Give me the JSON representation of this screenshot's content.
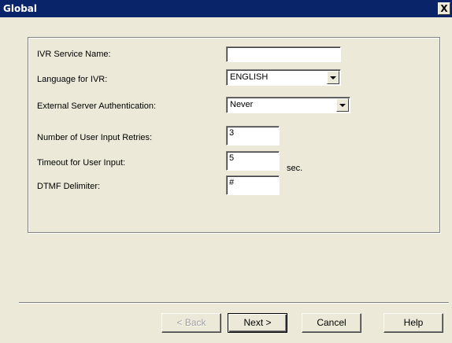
{
  "window": {
    "title": "Global",
    "close_glyph": "X"
  },
  "form": {
    "service_name": {
      "label": "IVR Service Name:",
      "value": ""
    },
    "language": {
      "label": "Language for IVR:",
      "value": "ENGLISH"
    },
    "ext_auth": {
      "label": "External Server Authentication:",
      "value": "Never"
    },
    "retries": {
      "label": "Number of User Input Retries:",
      "value": "3"
    },
    "timeout": {
      "label": "Timeout for User Input:",
      "value": "5",
      "unit": "sec."
    },
    "dtmf": {
      "label": "DTMF Delimiter:",
      "value": "#"
    }
  },
  "buttons": {
    "back": "< Back",
    "next": "Next >",
    "cancel": "Cancel",
    "help": "Help"
  }
}
